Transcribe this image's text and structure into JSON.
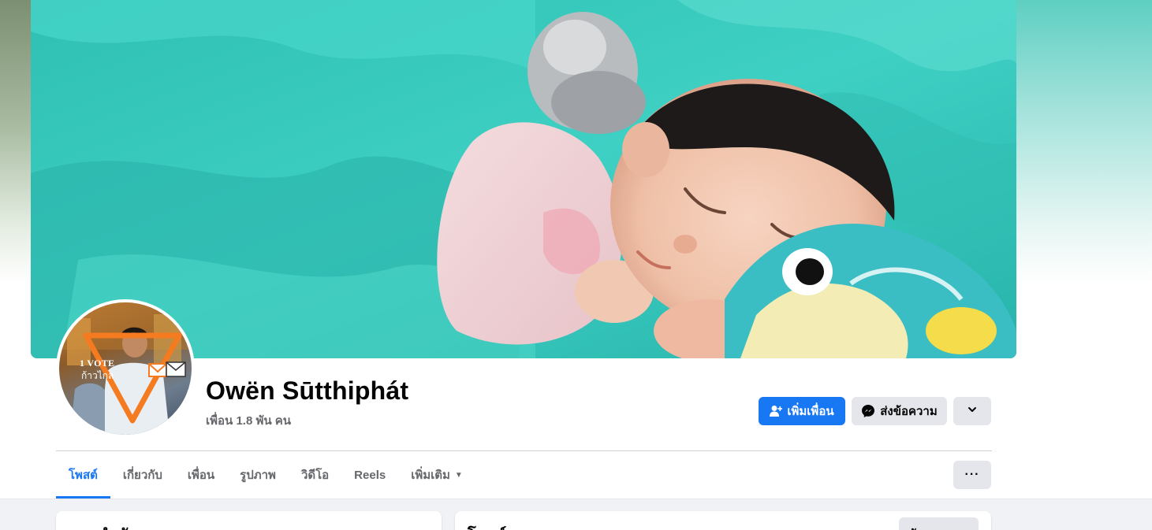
{
  "profile": {
    "name": "Owën Sūtthiphát",
    "friends_count": "เพื่อน 1.8 พัน คน",
    "avatar_overlay_text": "1 VOTE",
    "avatar_overlay_text2": "ก้าวไกล"
  },
  "actions": {
    "add_friend": "เพิ่มเพื่อน",
    "message": "ส่งข้อความ",
    "add_friend_icon": "add-friend-icon",
    "message_icon": "messenger-icon",
    "more_icon": "chevron-down-icon"
  },
  "tabs": [
    {
      "label": "โพสต์",
      "active": true
    },
    {
      "label": "เกี่ยวกับ",
      "active": false
    },
    {
      "label": "เพื่อน",
      "active": false
    },
    {
      "label": "รูปภาพ",
      "active": false
    },
    {
      "label": "วิดีโอ",
      "active": false
    },
    {
      "label": "Reels",
      "active": false
    },
    {
      "label": "เพิ่มเติม",
      "active": false
    }
  ],
  "tabs_more_label": "···",
  "cards": {
    "left_title": "แนะนำตัว",
    "right_title": "โพสต์",
    "filter_label": "ตัวกรอง"
  },
  "colors": {
    "accent": "#1877f2",
    "button_gray": "#e4e6eb",
    "muted_text": "#65676b",
    "page_gray": "#f0f2f5"
  }
}
